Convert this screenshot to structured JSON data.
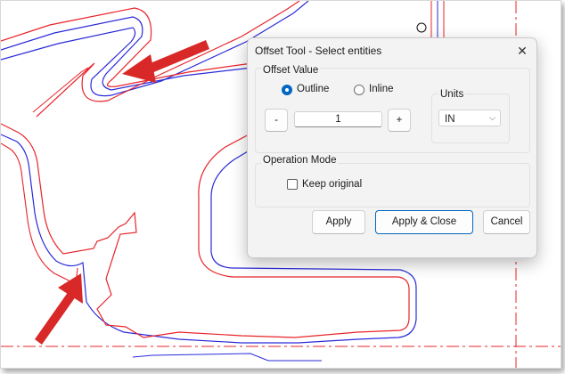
{
  "dialog": {
    "title": "Offset Tool - Select entities",
    "close_glyph": "✕",
    "offset_value": {
      "label": "Offset Value",
      "outline_label": "Outline",
      "inline_label": "Inline",
      "selected": "Outline",
      "minus_label": "-",
      "plus_label": "+",
      "value": "1"
    },
    "units": {
      "label": "Units",
      "selected": "IN",
      "chevron": "⌵"
    },
    "operation_mode": {
      "label": "Operation Mode",
      "keep_original_label": "Keep original",
      "keep_original_checked": false
    },
    "buttons": {
      "apply": "Apply",
      "apply_close": "Apply & Close",
      "cancel": "Cancel"
    }
  },
  "colors": {
    "offset_line": "#2b2bd9",
    "original_line": "#e8242b",
    "arrow": "#d82828",
    "accent": "#0067c0"
  },
  "icons": [
    "close-icon",
    "chevron-down-icon",
    "arrow-icon"
  ]
}
